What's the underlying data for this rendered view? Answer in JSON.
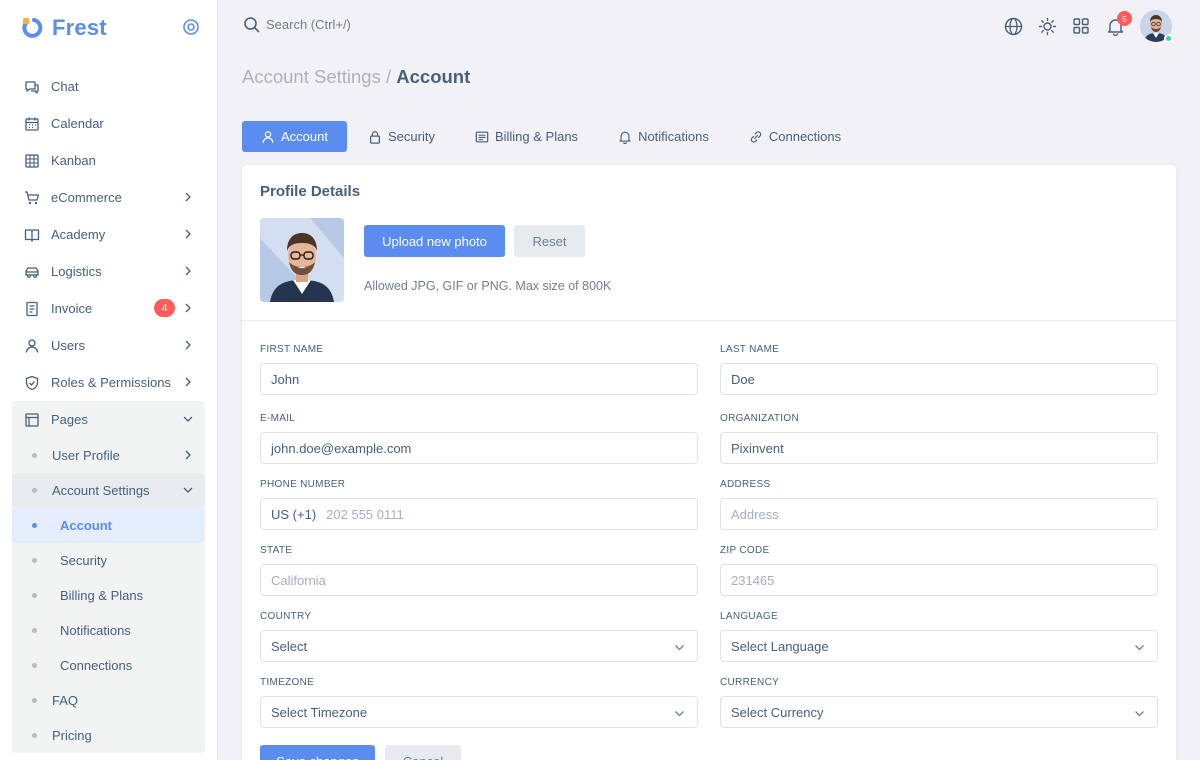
{
  "brand": {
    "name": "Frest",
    "accent": "#5a8dee"
  },
  "search": {
    "placeholder": "Search (Ctrl+/)"
  },
  "topbar": {
    "notifications_count": "5"
  },
  "nav": {
    "items": [
      {
        "label": "Chat",
        "icon": "chat-icon"
      },
      {
        "label": "Calendar",
        "icon": "calendar-icon"
      },
      {
        "label": "Kanban",
        "icon": "kanban-icon"
      },
      {
        "label": "eCommerce",
        "icon": "cart-icon"
      },
      {
        "label": "Academy",
        "icon": "book-icon"
      },
      {
        "label": "Logistics",
        "icon": "truck-icon"
      },
      {
        "label": "Invoice",
        "icon": "invoice-icon",
        "badge": "4"
      },
      {
        "label": "Users",
        "icon": "user-icon"
      },
      {
        "label": "Roles & Permissions",
        "icon": "shield-icon"
      },
      {
        "label": "Pages",
        "icon": "pages-icon"
      }
    ],
    "pages_children": {
      "user_profile": "User Profile",
      "account_settings": "Account Settings",
      "account_settings_children": [
        "Account",
        "Security",
        "Billing & Plans",
        "Notifications",
        "Connections"
      ],
      "faq": "FAQ",
      "pricing": "Pricing"
    }
  },
  "page": {
    "title_muted": "Account Settings /",
    "title_strong": "Account"
  },
  "tabs": [
    {
      "label": "Account",
      "icon": "user-icon",
      "active": true
    },
    {
      "label": "Security",
      "icon": "lock-icon"
    },
    {
      "label": "Billing & Plans",
      "icon": "billing-icon"
    },
    {
      "label": "Notifications",
      "icon": "bell-icon"
    },
    {
      "label": "Connections",
      "icon": "link-icon"
    }
  ],
  "profile": {
    "title": "Profile Details",
    "upload_label": "Upload new photo",
    "reset_label": "Reset",
    "help": "Allowed JPG, GIF or PNG. Max size of 800K"
  },
  "form": {
    "first_name": {
      "label": "First Name",
      "value": "John"
    },
    "last_name": {
      "label": "Last Name",
      "value": "Doe"
    },
    "email": {
      "label": "E-mail",
      "value": "john.doe@example.com"
    },
    "organization": {
      "label": "Organization",
      "value": "Pixinvent"
    },
    "phone": {
      "label": "Phone Number",
      "prefix": "US (+1)",
      "placeholder": "202 555 0111"
    },
    "address": {
      "label": "Address",
      "placeholder": "Address"
    },
    "state": {
      "label": "State",
      "placeholder": "California"
    },
    "zip": {
      "label": "Zip Code",
      "placeholder": "231465"
    },
    "country": {
      "label": "Country",
      "value": "Select"
    },
    "language": {
      "label": "Language",
      "value": "Select Language"
    },
    "timezone": {
      "label": "Timezone",
      "value": "Select Timezone"
    },
    "currency": {
      "label": "Currency",
      "value": "Select Currency"
    },
    "save_label": "Save changes",
    "cancel_label": "Cancel"
  }
}
